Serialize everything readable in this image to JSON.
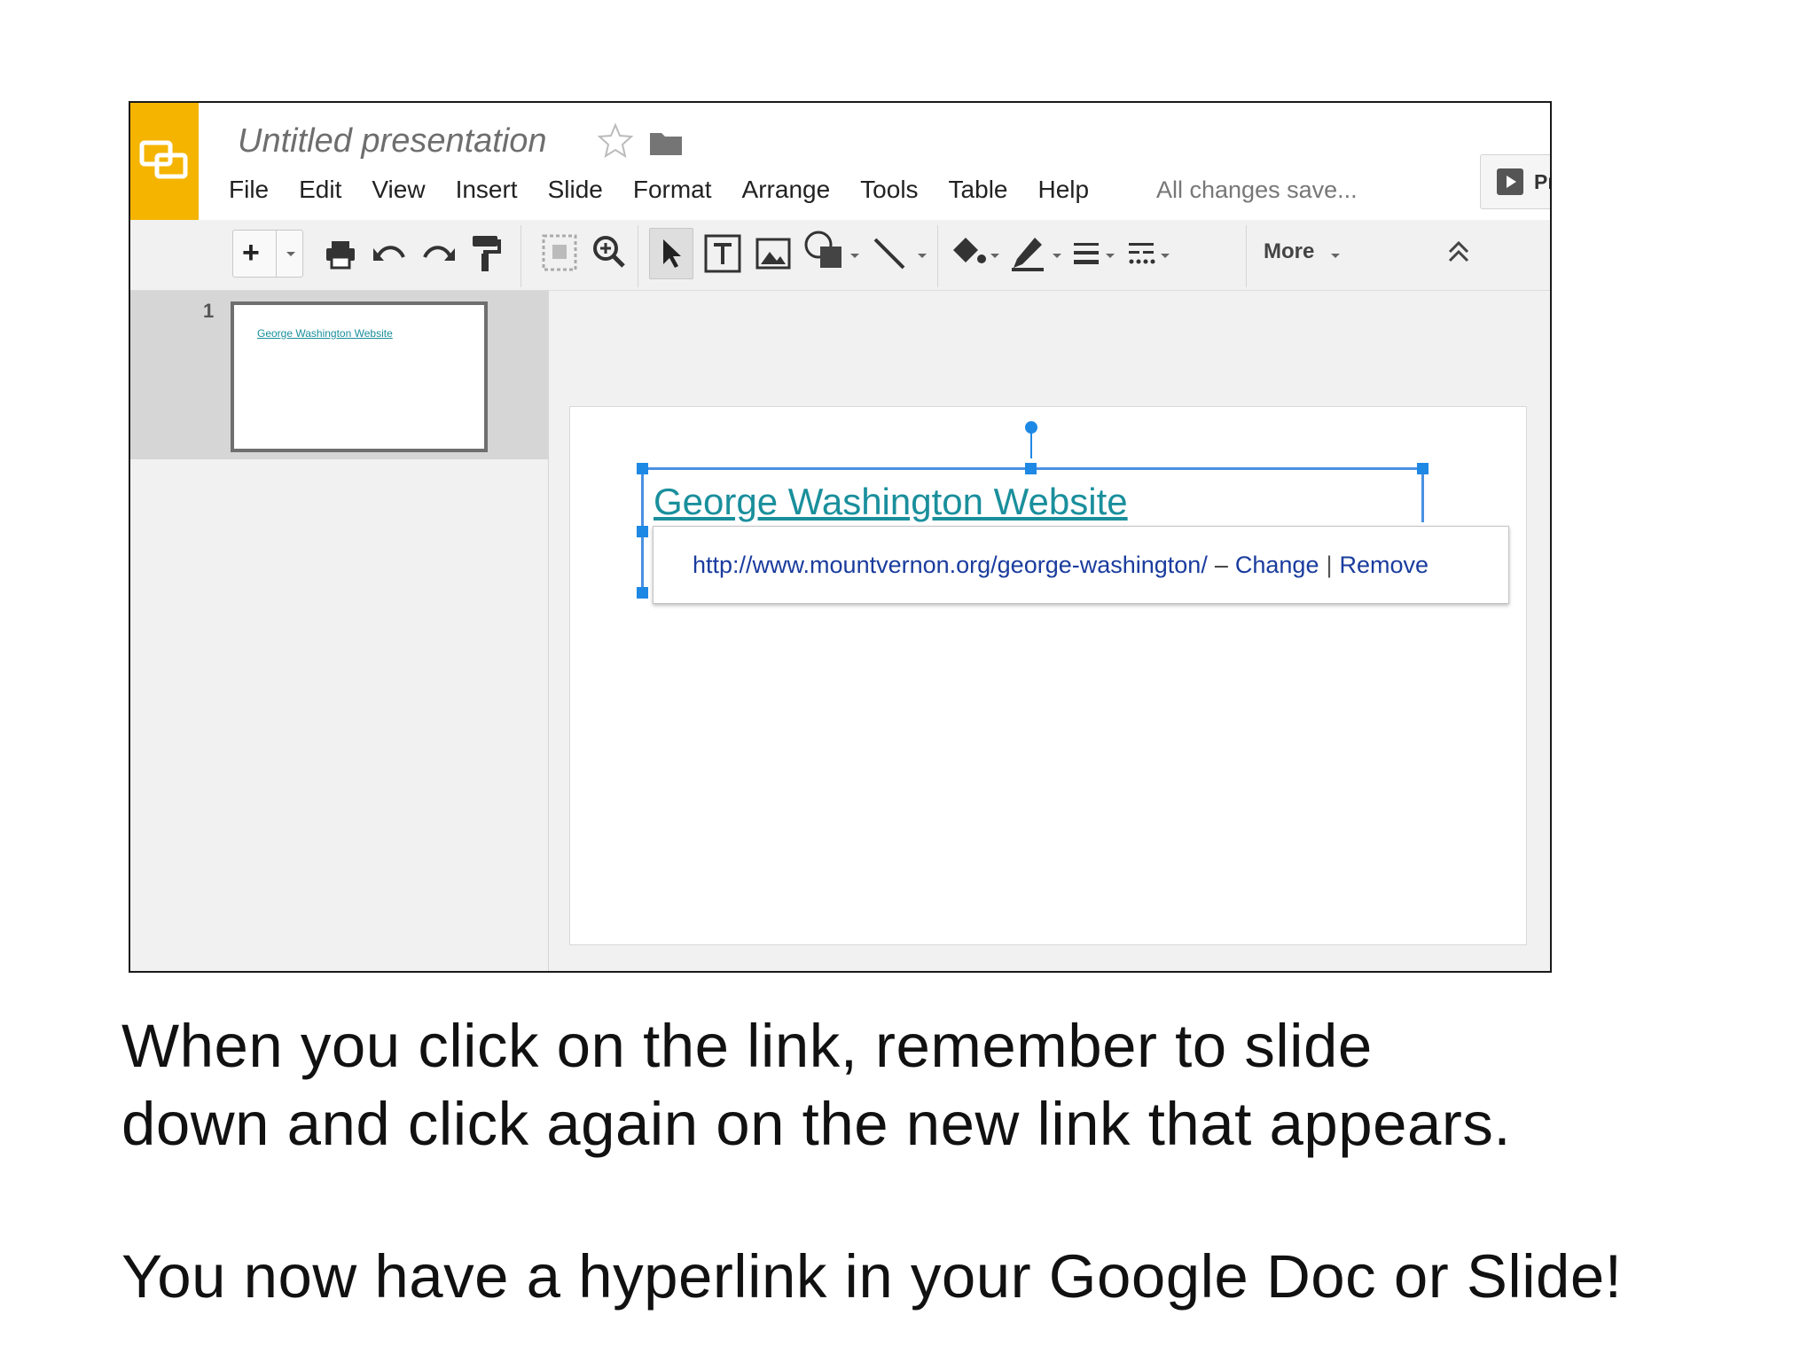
{
  "app": {
    "document_title": "Untitled presentation",
    "save_status": "All changes save...",
    "present_label": "Present",
    "menu": [
      "File",
      "Edit",
      "View",
      "Insert",
      "Slide",
      "Format",
      "Arrange",
      "Tools",
      "Table",
      "Help"
    ]
  },
  "toolbar": {
    "new_slide_label": "+",
    "more_label": "More",
    "icons": [
      "new-slide-icon",
      "print-icon",
      "undo-icon",
      "redo-icon",
      "paint-format-icon",
      "zoom-fit-icon",
      "zoom-icon",
      "select-icon",
      "text-box-icon",
      "image-icon",
      "shape-icon",
      "line-icon",
      "fill-color-icon",
      "border-color-icon",
      "border-weight-icon",
      "border-dash-icon",
      "collapse-icon"
    ]
  },
  "filmstrip": {
    "slide_number": "1",
    "thumbnail_text": "George Washington Website"
  },
  "slide": {
    "link_text": "George Washington Website",
    "link_bubble": {
      "url": "http://www.mountvernon.org/george-washington/",
      "separator": "–",
      "change": "Change",
      "pipe": "|",
      "remove": "Remove"
    }
  },
  "caption": {
    "line1": "When you click on the link, remember to slide",
    "line2": "down and click again on the new link that appears.",
    "line3": "You now have a hyperlink in your Google Doc or Slide!"
  },
  "colors": {
    "brand_yellow": "#f4b400",
    "link_teal": "#1a8f9c",
    "link_blue": "#1a3c9e",
    "selection_blue": "#1e88e5"
  }
}
